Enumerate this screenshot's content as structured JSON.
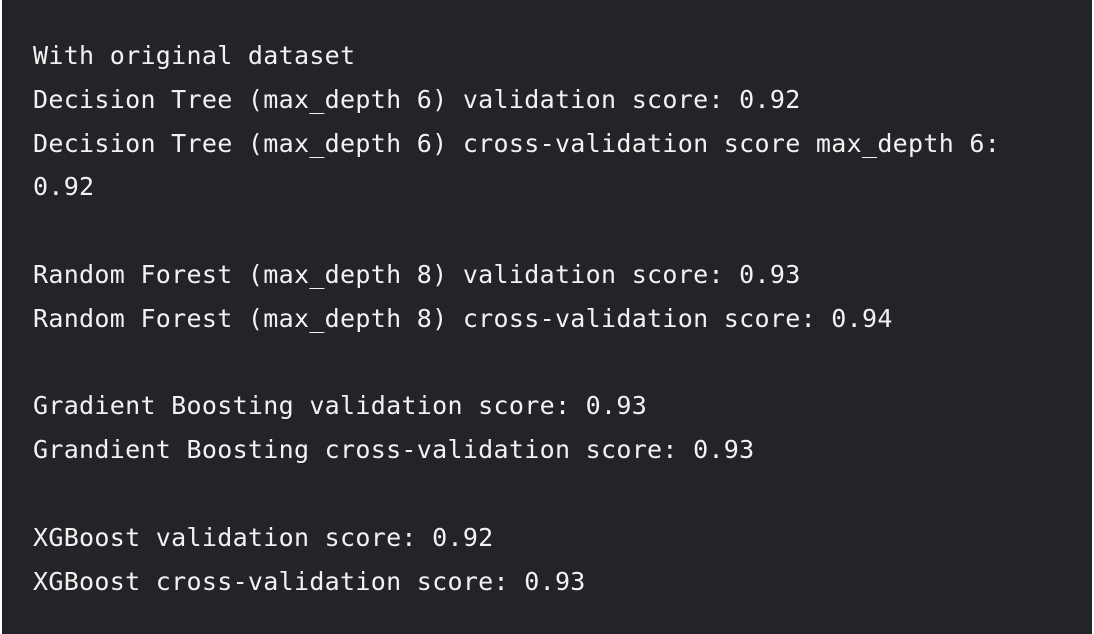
{
  "console": {
    "lines": [
      "With original dataset",
      "Decision Tree (max_depth 6) validation score: 0.92",
      "Decision Tree (max_depth 6) cross-validation score max_depth 6:",
      "0.92",
      "",
      "Random Forest (max_depth 8) validation score: 0.93",
      "Random Forest (max_depth 8) cross-validation score: 0.94",
      "",
      "Gradient Boosting validation score: 0.93",
      "Grandient Boosting cross-validation score: 0.93",
      "",
      "XGBoost validation score: 0.92",
      "XGBoost cross-validation score: 0.93"
    ]
  }
}
